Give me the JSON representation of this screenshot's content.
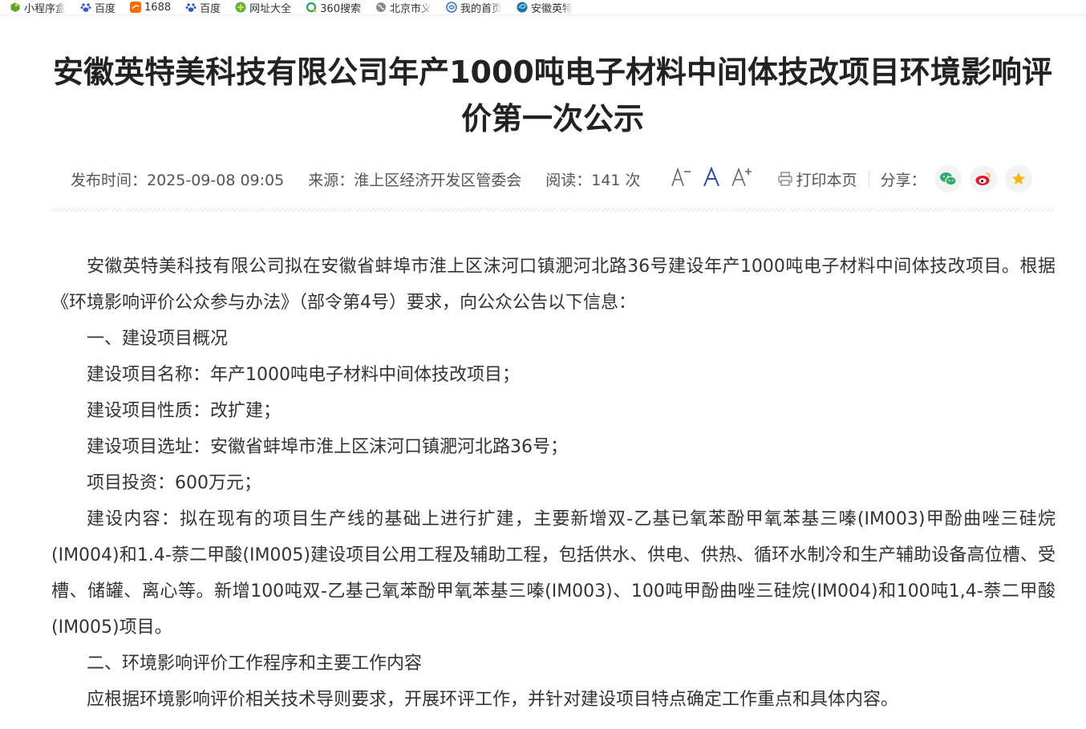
{
  "bookmarks": [
    {
      "label": "小程序盒",
      "icon": "mini-program-icon",
      "color": "#5aa532"
    },
    {
      "label": "百度",
      "icon": "baidu-paw-icon",
      "color": "#3059d7"
    },
    {
      "label": "1688",
      "icon": "alibaba-1688-icon",
      "color": "#ff6a00"
    },
    {
      "label": "百度",
      "icon": "baidu-paw-icon",
      "color": "#3059d7"
    },
    {
      "label": "网址大全",
      "icon": "url-directory-icon",
      "color": "#4db34d"
    },
    {
      "label": "360搜索",
      "icon": "search-360-icon",
      "color": "#21a35b"
    },
    {
      "label": "北京市义",
      "icon": "globe-icon",
      "color": "#8a8a8a"
    },
    {
      "label": "我的首页",
      "icon": "homepage-link-icon",
      "color": "#3a73d9"
    },
    {
      "label": "安徽英特",
      "icon": "edge-tab-icon",
      "color": "#1e6ea8"
    }
  ],
  "article": {
    "title": "安徽英特美科技有限公司年产1000吨电子材料中间体技改项目环境影响评价第一次公示",
    "meta": {
      "publish_time": "发布时间：2025-09-08 09:05",
      "source": "来源：淮上区经济开发区管委会",
      "reads": "阅读：141 次",
      "print_label": "打印本页",
      "share_label": "分享："
    },
    "paragraphs": [
      "安徽英特美科技有限公司拟在安徽省蚌埠市淮上区沫河口镇淝河北路36号建设年产1000吨电子材料中间体技改项目。根据《环境影响评价公众参与办法》（部令第4号）要求，向公众公告以下信息：",
      "一、建设项目概况",
      "建设项目名称：年产1000吨电子材料中间体技改项目；",
      "建设项目性质：改扩建；",
      "建设项目选址：安徽省蚌埠市淮上区沫河口镇淝河北路36号；",
      "项目投资：600万元；",
      "建设内容：拟在现有的项目生产线的基础上进行扩建，主要新增双-乙基已氧苯酚甲氧苯基三嗪(IM003)甲酚曲唑三硅烷(IM004)和1.4-萘二甲酸(IM005)建设项目公用工程及辅助工程，包括供水、供电、供热、循环水制冷和生产辅助设备高位槽、受槽、储罐、离心等。新增100吨双-乙基己氧苯酚甲氧苯基三嗪(IM003)、100吨甲酚曲唑三硅烷(IM004)和100吨1,4-萘二甲酸(IM005)项目。",
      "二、环境影响评价工作程序和主要工作内容",
      "应根据环境影响评价相关技术导则要求，开展环评工作，并针对建设项目特点确定工作重点和具体内容。"
    ]
  },
  "colors": {
    "title": "#222222",
    "text": "#333333",
    "meta": "#555555",
    "font_tool_accent": "#2c4f9e",
    "wechat": "#2aae67",
    "weibo": "#e6162d",
    "favorite": "#f5b800"
  }
}
